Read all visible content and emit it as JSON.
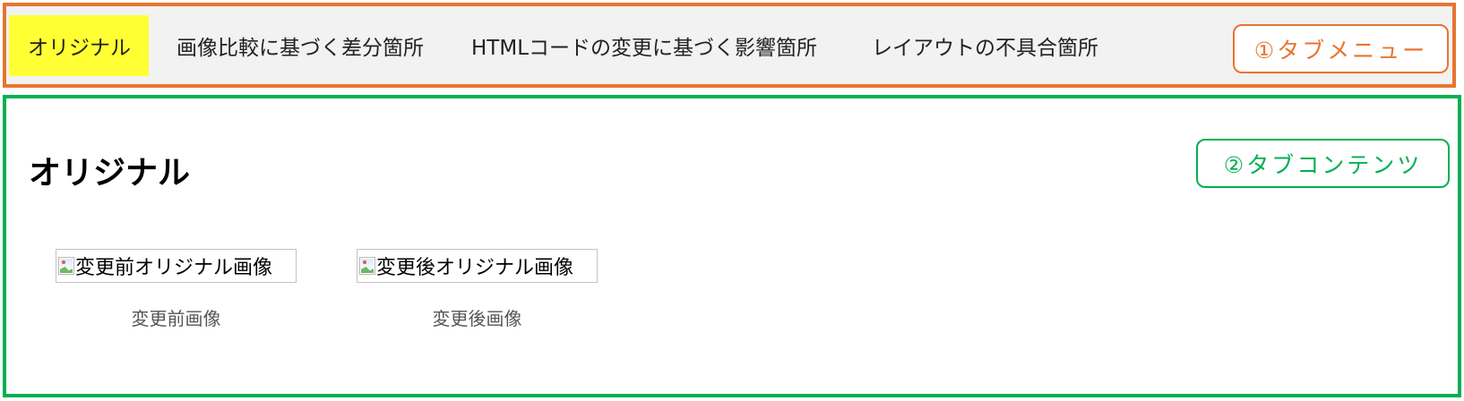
{
  "tab_menu": {
    "tabs": [
      {
        "label": "オリジナル",
        "active": true
      },
      {
        "label": "画像比較に基づく差分箇所",
        "active": false
      },
      {
        "label": "HTMLコードの変更に基づく影響箇所",
        "active": false
      },
      {
        "label": "レイアウトの不具合箇所",
        "active": false
      }
    ],
    "callout_label": "①タブメニュー",
    "frame_color": "#E8742F",
    "active_tab_color": "#FFFF33"
  },
  "tab_content": {
    "title": "オリジナル",
    "callout_label": "②タブコンテンツ",
    "frame_color": "#00B050",
    "images": [
      {
        "alt": "変更前オリジナル画像",
        "caption": "変更前画像",
        "icon": "broken-image-icon"
      },
      {
        "alt": "変更後オリジナル画像",
        "caption": "変更後画像",
        "icon": "broken-image-icon"
      }
    ]
  }
}
